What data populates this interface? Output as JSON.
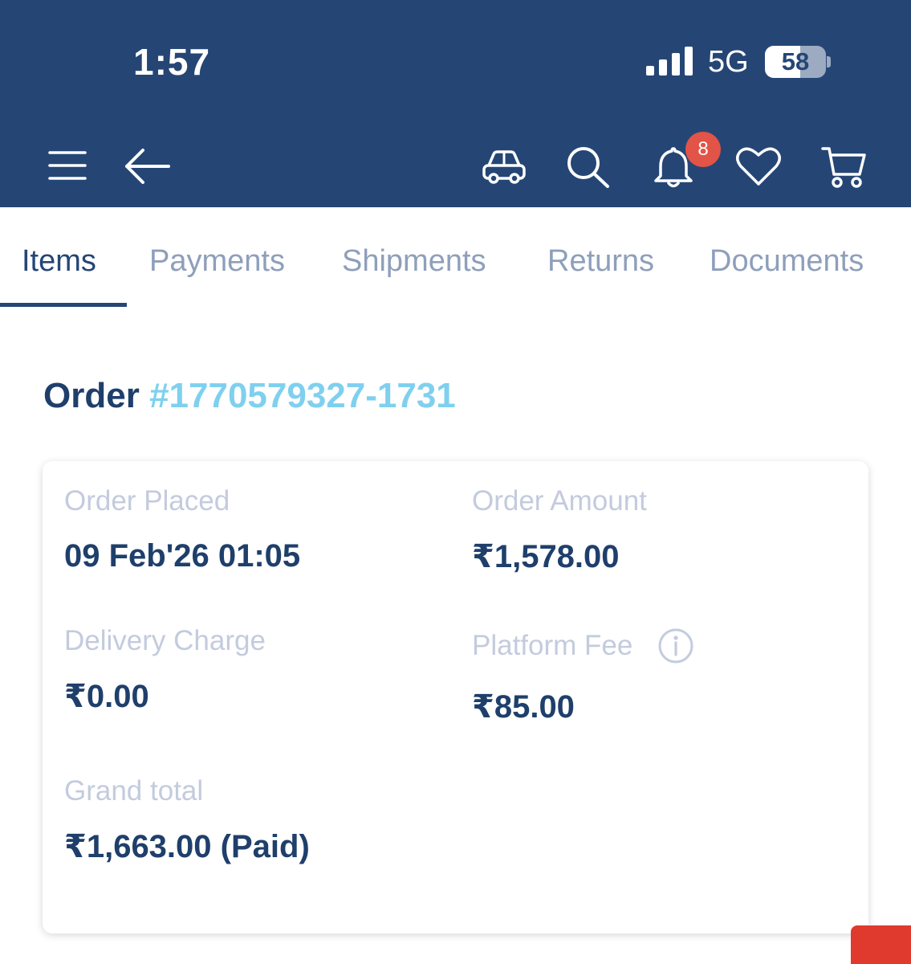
{
  "status_bar": {
    "time": "1:57",
    "network": "5G",
    "battery": "58",
    "battery_level": 0.58
  },
  "app_bar": {
    "icons": [
      "menu-icon",
      "back-arrow-icon",
      "car-icon",
      "search-icon",
      "bell-icon",
      "heart-icon",
      "cart-icon"
    ],
    "notification_count": "8"
  },
  "tabs": [
    {
      "label": "Items",
      "active": true
    },
    {
      "label": "Payments",
      "active": false
    },
    {
      "label": "Shipments",
      "active": false
    },
    {
      "label": "Returns",
      "active": false
    },
    {
      "label": "Documents",
      "active": false
    }
  ],
  "order": {
    "title_prefix": "Order",
    "number": "#1770579327-1731"
  },
  "summary": {
    "order_placed_label": "Order Placed",
    "order_placed_value": "09 Feb'26 01:05",
    "order_amount_label": "Order Amount",
    "order_amount_value": "₹1,578.00",
    "delivery_charge_label": "Delivery Charge",
    "delivery_charge_value": "₹0.00",
    "platform_fee_label": "Platform Fee",
    "platform_fee_value": "₹85.00",
    "grand_total_label": "Grand total",
    "grand_total_value": "₹1,663.00 (Paid)"
  },
  "colors": {
    "header_bg": "#254675",
    "accent_link": "#7fd0ef",
    "badge": "#e25447",
    "tab_inactive": "#8e9fba",
    "label_muted": "#c3cbdd"
  }
}
